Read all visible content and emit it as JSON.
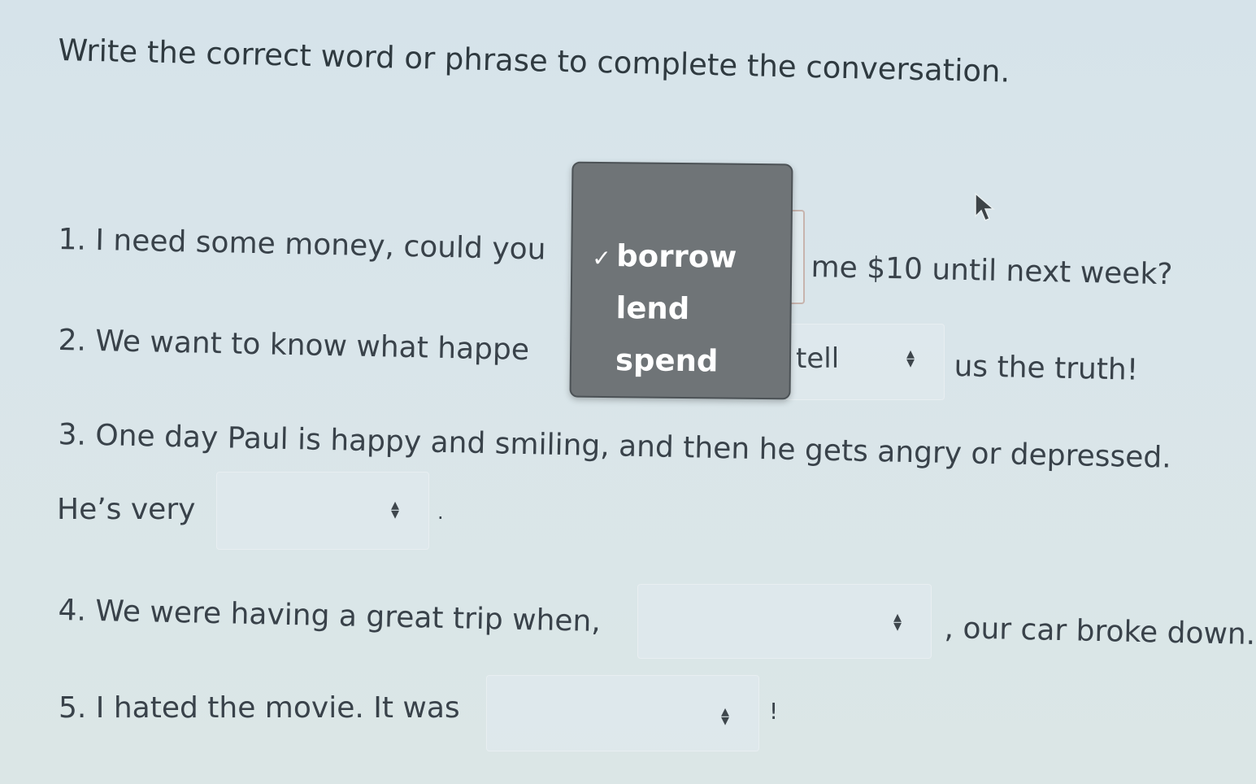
{
  "instructions": "Write the correct word or phrase to complete the conversation.",
  "questions": {
    "q1": {
      "before": "1. I need some money, could you",
      "after": "me $10 until next week?"
    },
    "q2": {
      "before": "2. We want to know what happe",
      "selected": "tell",
      "after": "us the truth!"
    },
    "q3": {
      "text": "3. One day Paul is happy and smiling, and then he gets angry or depressed.",
      "before": "He’s very",
      "after": "."
    },
    "q4": {
      "before": "4. We were having a great trip when,",
      "after": ", our car broke down."
    },
    "q5": {
      "before": "5. I hated the movie. It was",
      "after": "!"
    }
  },
  "dropdown": {
    "options": [
      "borrow",
      "lend",
      "spend"
    ],
    "selected": "borrow",
    "check_icon": "check-icon"
  },
  "icons": {
    "arrows": "up-down-arrows-icon",
    "cursor": "mouse-pointer-icon"
  },
  "colors": {
    "dropdown_bg": "#6f7477",
    "text": "#39424a"
  }
}
